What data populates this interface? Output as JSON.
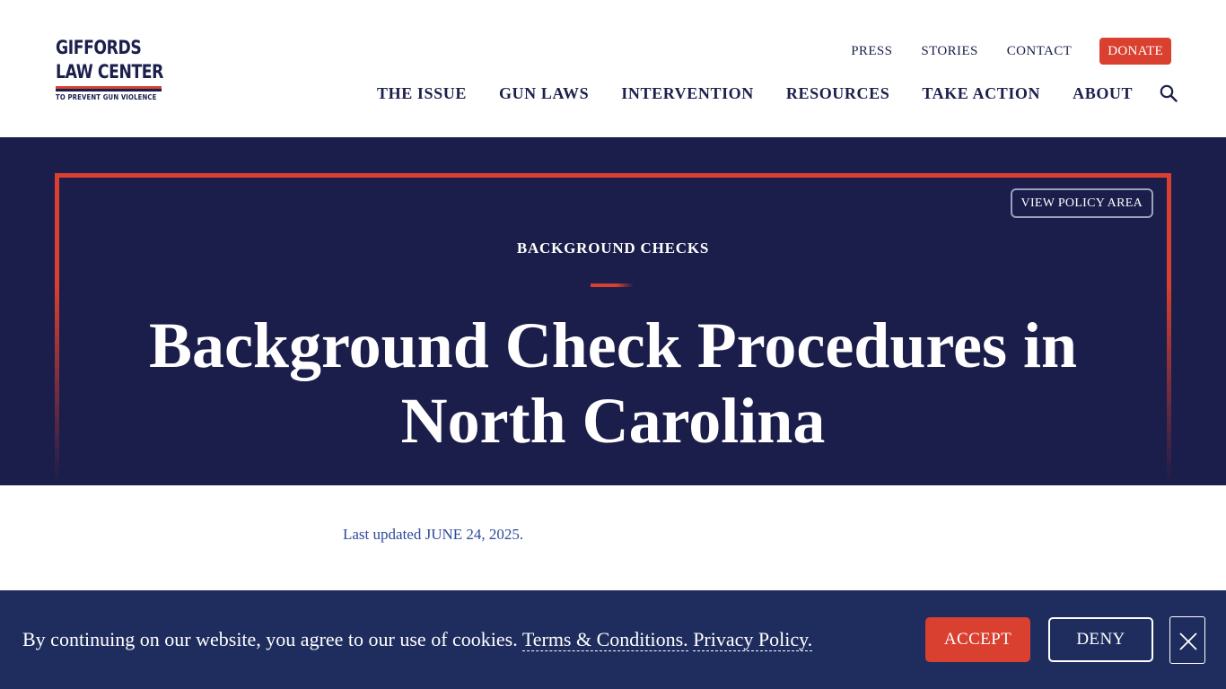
{
  "logo": {
    "line1": "GIFFORDS",
    "line2": "LAW CENTER",
    "tagline": "TO PREVENT GUN VIOLENCE"
  },
  "utility_nav": {
    "press": "PRESS",
    "stories": "STORIES",
    "contact": "CONTACT",
    "donate": "DONATE"
  },
  "main_nav": {
    "items": [
      "THE ISSUE",
      "GUN LAWS",
      "INTERVENTION",
      "RESOURCES",
      "TAKE ACTION",
      "ABOUT"
    ],
    "search_icon": "search-icon"
  },
  "hero": {
    "policy_button": "VIEW POLICY AREA",
    "eyebrow": "BACKGROUND CHECKS",
    "title_line1": "Background Check Procedures in",
    "title_line2": "North Carolina"
  },
  "content": {
    "updated": "Last updated JUNE 24, 2025."
  },
  "cookie_banner": {
    "text": "By continuing on our website, you agree to our use of cookies.",
    "terms_link": "Terms & Conditions.",
    "privacy_link": "Privacy Policy.",
    "accept": "ACCEPT",
    "deny": "DENY",
    "close_icon": "close-icon"
  },
  "colors": {
    "navy": "#1b1d4b",
    "accent_red": "#d9402f",
    "banner_blue": "#1f2d5e",
    "link_blue": "#2f4a9a"
  }
}
